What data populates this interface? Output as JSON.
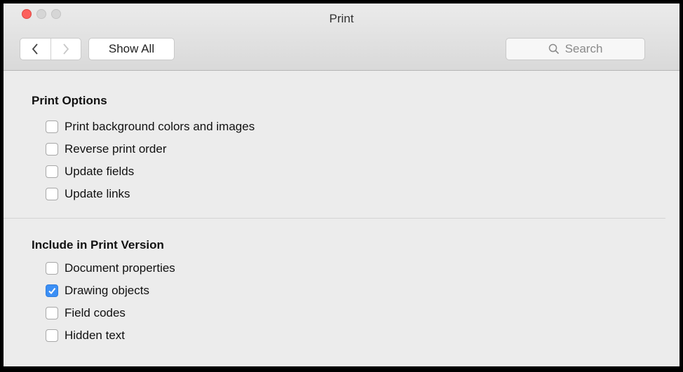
{
  "window": {
    "title": "Print"
  },
  "toolbar": {
    "back_icon": "chevron-left-icon",
    "forward_icon": "chevron-right-icon",
    "show_all_label": "Show All",
    "search_placeholder": "Search"
  },
  "print_options": {
    "heading": "Print Options",
    "items": [
      {
        "label": "Print background colors and images",
        "checked": false
      },
      {
        "label": "Reverse print order",
        "checked": false
      },
      {
        "label": "Update fields",
        "checked": false
      },
      {
        "label": "Update links",
        "checked": false
      }
    ]
  },
  "include_in_print": {
    "heading": "Include in Print Version",
    "items": [
      {
        "label": "Document properties",
        "checked": false
      },
      {
        "label": "Drawing objects",
        "checked": true
      },
      {
        "label": "Field codes",
        "checked": false
      },
      {
        "label": "Hidden text",
        "checked": false
      }
    ]
  },
  "colors": {
    "accent": "#3b8ff5",
    "close": "#fc605c"
  }
}
